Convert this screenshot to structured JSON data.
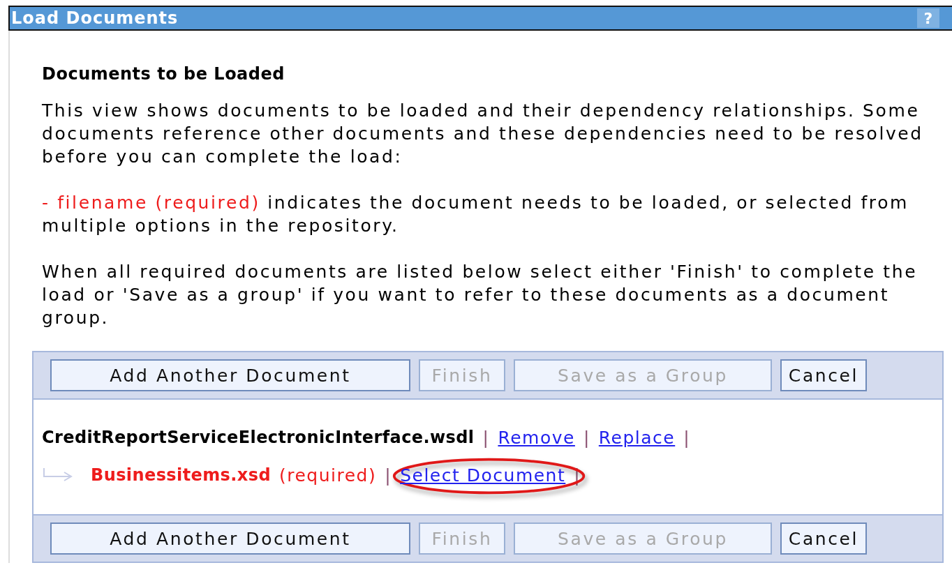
{
  "window": {
    "title": "Load Documents",
    "help": "?"
  },
  "heading": "Documents to be Loaded",
  "intro": "This view shows documents to be loaded and their dependency relationships. Some documents reference other documents and these dependencies need to be resolved before you can complete the load:",
  "legend": {
    "marker": "- filename (required)",
    "text": " indicates the document needs to be loaded, or selected from multiple options in the repository."
  },
  "instructions": "When all required documents are listed below select either 'Finish' to complete the load or 'Save as a group' if you want to refer to these documents as a document group.",
  "toolbar_top": [
    {
      "label": "Add Another Document",
      "disabled": false,
      "kind": "wide"
    },
    {
      "label": "Finish",
      "disabled": true,
      "kind": "small"
    },
    {
      "label": "Save as a Group",
      "disabled": true,
      "kind": "medium"
    },
    {
      "label": "Cancel",
      "disabled": false,
      "kind": "small"
    }
  ],
  "documents": [
    {
      "name": "CreditReportServiceElectronicInterface.wsdl",
      "required": false,
      "separator": "|",
      "actions": [
        {
          "label": "Remove"
        },
        {
          "label": "Replace"
        }
      ],
      "children": [
        {
          "name": "Businessitems.xsd",
          "required": true,
          "status": "(required)",
          "separator": "|",
          "actions": [
            {
              "label": "Select Document",
              "highlighted": true
            }
          ]
        }
      ]
    }
  ],
  "toolbar_bottom": [
    {
      "label": "Add Another Document",
      "disabled": false,
      "kind": "wide"
    },
    {
      "label": "Finish",
      "disabled": true,
      "kind": "small"
    },
    {
      "label": "Save as a Group",
      "disabled": true,
      "kind": "medium"
    },
    {
      "label": "Cancel",
      "disabled": false,
      "kind": "small"
    }
  ]
}
